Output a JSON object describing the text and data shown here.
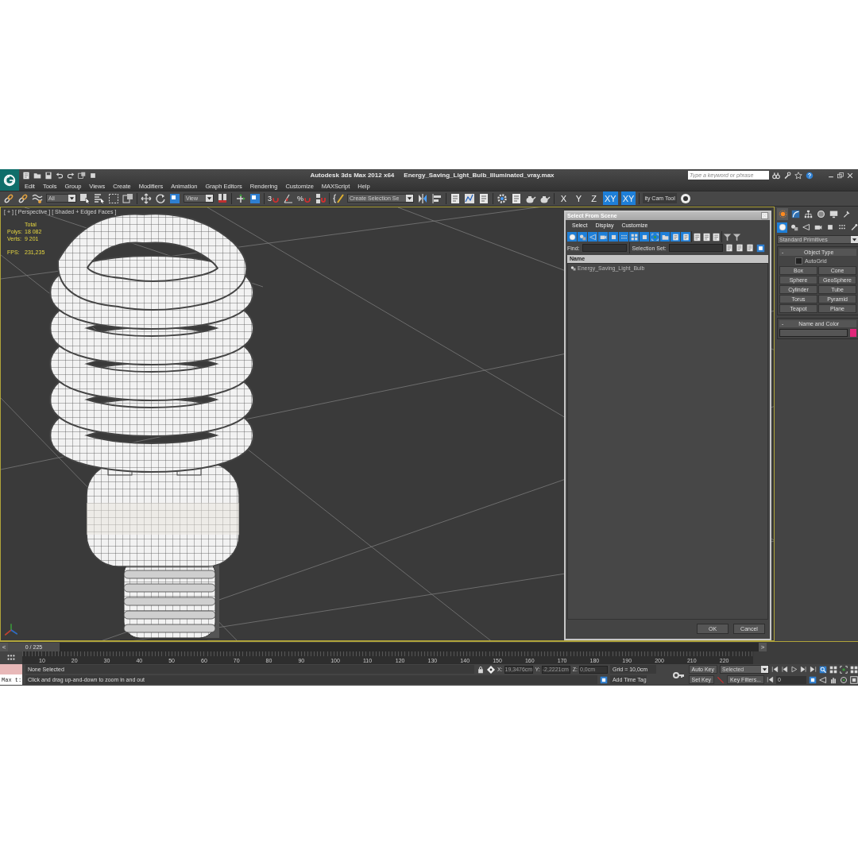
{
  "window": {
    "title": "Autodesk 3ds Max  2012 x64",
    "file": "Energy_Saving_Light_Bulb_Illuminated_vray.max"
  },
  "search": {
    "placeholder": "Type a keyword or phrase"
  },
  "menu": [
    "Edit",
    "Tools",
    "Group",
    "Views",
    "Create",
    "Modifiers",
    "Animation",
    "Graph Editors",
    "Rendering",
    "Customize",
    "MAXScript",
    "Help"
  ],
  "toolbar": {
    "selection_filter": "All",
    "reference_coord": "View",
    "snap_labels": [
      "3",
      "%"
    ],
    "named_selection": "Create Selection Se",
    "cam_tool": "ity Cam Tool",
    "axis_buttons": [
      {
        "label": "X",
        "selected": false
      },
      {
        "label": "Y",
        "selected": false
      },
      {
        "label": "Z",
        "selected": false
      },
      {
        "label": "XY",
        "selected": true
      },
      {
        "label": "XY",
        "selected": true
      }
    ]
  },
  "viewport": {
    "labels": [
      "[ + ]",
      "[ Perspective ]",
      "[ Shaded + Edged Faces ]"
    ],
    "stats_heading": "Total",
    "stats": [
      {
        "label": "Polys:",
        "value": "18 082"
      },
      {
        "label": "Verts:",
        "value": "9 201"
      },
      {
        "label": "FPS:",
        "value": "231,235"
      }
    ]
  },
  "dialog": {
    "title": "Select From Scene",
    "menu": [
      "Select",
      "Display",
      "Customize"
    ],
    "filter_toggles": [
      {
        "selected": true
      },
      {
        "selected": true
      },
      {
        "selected": true
      },
      {
        "selected": true
      },
      {
        "selected": true
      },
      {
        "selected": true
      },
      {
        "selected": true
      },
      {
        "selected": true
      },
      {
        "selected": true
      },
      {
        "selected": true
      },
      {
        "selected": true
      },
      {
        "selected": true
      }
    ],
    "find_label": "Find:",
    "selection_set_label": "Selection Set:",
    "column": "Name",
    "items": [
      {
        "name": "Energy_Saving_Light_Bulb"
      }
    ],
    "buttons": [
      "OK",
      "Cancel"
    ]
  },
  "command_panel": {
    "tabs": [
      {
        "selected": true
      },
      {
        "selected": false
      },
      {
        "selected": false
      },
      {
        "selected": false
      },
      {
        "selected": false
      },
      {
        "selected": false
      }
    ],
    "categories": [
      {
        "selected": true
      },
      {
        "selected": false
      },
      {
        "selected": false
      },
      {
        "selected": false
      },
      {
        "selected": false
      },
      {
        "selected": false
      },
      {
        "selected": false
      }
    ],
    "dropdown": "Standard Primitives",
    "object_type": {
      "heading": "Object Type",
      "collapse": "-",
      "autogrid": {
        "label": "AutoGrid",
        "checked": false
      },
      "buttons": [
        "Box",
        "Cone",
        "Sphere",
        "GeoSphere",
        "Cylinder",
        "Tube",
        "Torus",
        "Pyramid",
        "Teapot",
        "Plane"
      ]
    },
    "name_and_color": {
      "heading": "Name and Color",
      "collapse": "-",
      "color": "#e0287a"
    }
  },
  "timeline": {
    "prev": "<",
    "range": "0 / 225",
    "level": 0,
    "next": ">",
    "ticks": [
      "10",
      "20",
      "30",
      "40",
      "50",
      "60",
      "70",
      "80",
      "90",
      "100",
      "110",
      "120",
      "130",
      "140",
      "150",
      "160",
      "170",
      "180",
      "190",
      "200",
      "210",
      "220"
    ]
  },
  "status": {
    "listener": "Max t:",
    "selection": "None Selected",
    "prompt": "Click and drag up-and-down to zoom in and out",
    "coords": [
      {
        "label": "X:",
        "value": "19,3476cm"
      },
      {
        "label": "Y:",
        "value": "-2,2221cm"
      },
      {
        "label": "Z:",
        "value": "0,0cm"
      }
    ],
    "grid": "Grid = 10,0cm",
    "time_tag": "Add Time Tag",
    "auto_key": "Auto Key",
    "key_mode": "Selected",
    "set_key": "Set Key",
    "key_filters": "Key Filters...",
    "frame": "0"
  }
}
